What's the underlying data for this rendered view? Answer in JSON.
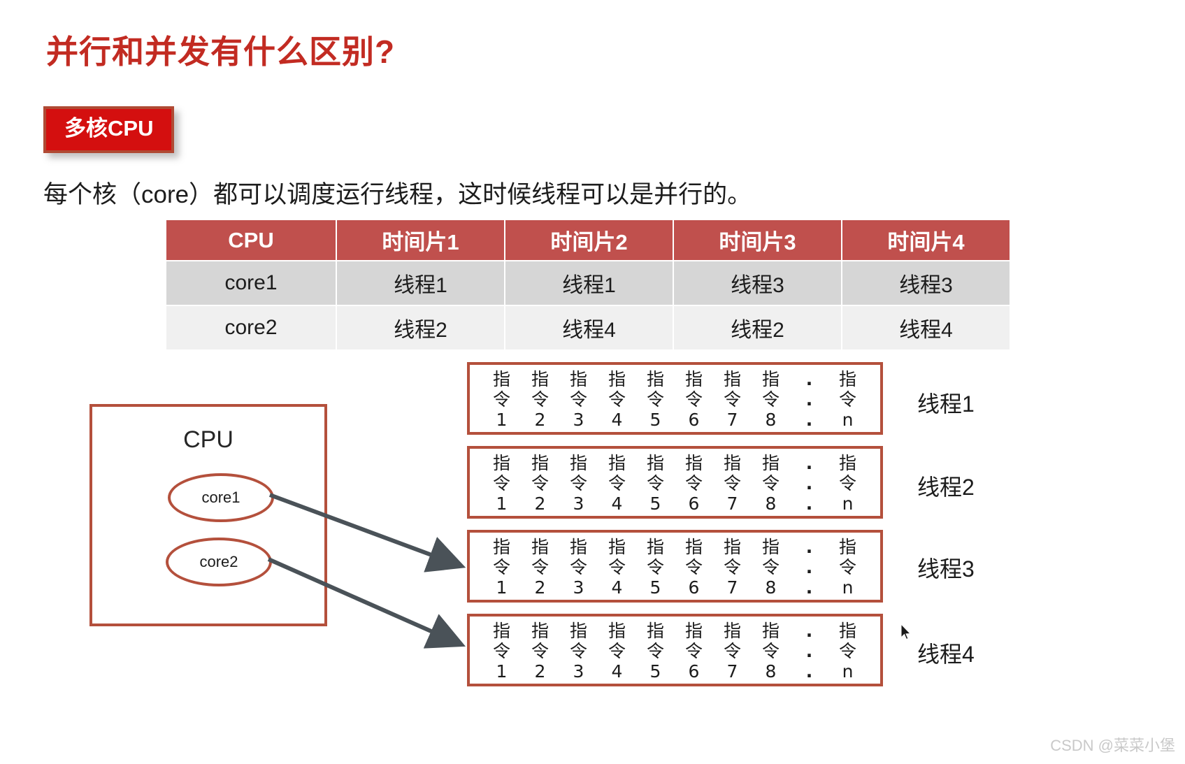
{
  "slide": {
    "title": "并行和并发有什么区别?",
    "badge_label": "多核CPU",
    "subtitle": "每个核（core）都可以调度运行线程，这时候线程可以是并行的。",
    "watermark": "CSDN @菜菜小堡"
  },
  "schedule_table": {
    "headers": [
      "CPU",
      "时间片1",
      "时间片2",
      "时间片3",
      "时间片4"
    ],
    "rows": [
      [
        "core1",
        "线程1",
        "线程1",
        "线程3",
        "线程3"
      ],
      [
        "core2",
        "线程2",
        "线程4",
        "线程2",
        "线程4"
      ]
    ]
  },
  "cpu_diagram": {
    "box_label": "CPU",
    "cores": [
      "core1",
      "core2"
    ]
  },
  "instruction_boxes": [
    {
      "thread_label": "线程1",
      "top_row": [
        "指",
        "指",
        "指",
        "指",
        "指",
        "指",
        "指",
        "指",
        ".",
        "指"
      ],
      "mid_row": [
        "令",
        "令",
        "令",
        "令",
        "令",
        "令",
        "令",
        "令",
        ".",
        "令"
      ],
      "num_row": [
        "1",
        "2",
        "3",
        "4",
        "5",
        "6",
        "7",
        "8",
        ".",
        "n"
      ]
    },
    {
      "thread_label": "线程2",
      "top_row": [
        "指",
        "指",
        "指",
        "指",
        "指",
        "指",
        "指",
        "指",
        ".",
        "指"
      ],
      "mid_row": [
        "令",
        "令",
        "令",
        "令",
        "令",
        "令",
        "令",
        "令",
        ".",
        "令"
      ],
      "num_row": [
        "1",
        "2",
        "3",
        "4",
        "5",
        "6",
        "7",
        "8",
        ".",
        "n"
      ]
    },
    {
      "thread_label": "线程3",
      "top_row": [
        "指",
        "指",
        "指",
        "指",
        "指",
        "指",
        "指",
        "指",
        ".",
        "指"
      ],
      "mid_row": [
        "令",
        "令",
        "令",
        "令",
        "令",
        "令",
        "令",
        "令",
        ".",
        "令"
      ],
      "num_row": [
        "1",
        "2",
        "3",
        "4",
        "5",
        "6",
        "7",
        "8",
        ".",
        "n"
      ]
    },
    {
      "thread_label": "线程4",
      "top_row": [
        "指",
        "指",
        "指",
        "指",
        "指",
        "指",
        "指",
        "指",
        ".",
        "指"
      ],
      "mid_row": [
        "令",
        "令",
        "令",
        "令",
        "令",
        "令",
        "令",
        "令",
        ".",
        "令"
      ],
      "num_row": [
        "1",
        "2",
        "3",
        "4",
        "5",
        "6",
        "7",
        "8",
        ".",
        "n"
      ]
    }
  ],
  "colors": {
    "title_red": "#c22b22",
    "badge_fill": "#d40f0f",
    "badge_border": "#b04a34",
    "table_header": "#c0504d",
    "row_a": "#d6d6d6",
    "row_b": "#f0f0f0",
    "diagram_border": "#b4503c",
    "arrow": "#4a5258"
  }
}
